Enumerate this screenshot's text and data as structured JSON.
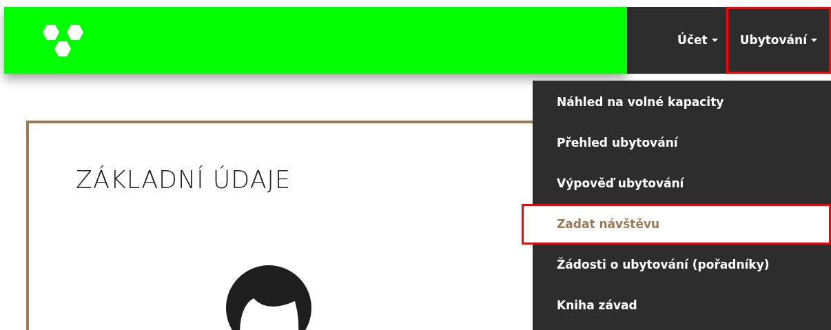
{
  "nav": [
    {
      "label": "Účet",
      "highlighted": false
    },
    {
      "label": "Ubytování",
      "highlighted": true
    }
  ],
  "dropdown": {
    "items": [
      {
        "label": "Náhled na volné kapacity",
        "selected": false,
        "highlighted": false
      },
      {
        "label": "Přehled ubytování",
        "selected": false,
        "highlighted": false
      },
      {
        "label": "Výpověď ubytování",
        "selected": false,
        "highlighted": false
      },
      {
        "label": "Zadat návštěvu",
        "selected": true,
        "highlighted": true
      },
      {
        "label": "Žádosti o ubytování (pořadníky)",
        "selected": false,
        "highlighted": false
      },
      {
        "label": "Kniha závad",
        "selected": false,
        "highlighted": false
      }
    ]
  },
  "card": {
    "title": "ZÁKLADNÍ ÚDAJE"
  }
}
